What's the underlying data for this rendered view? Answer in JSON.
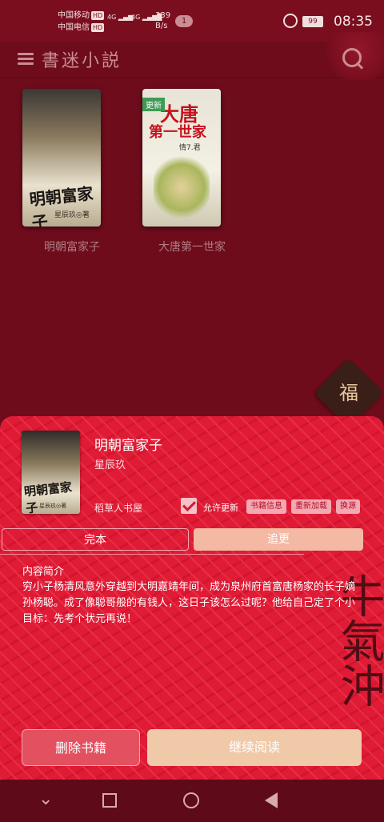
{
  "status_bar": {
    "carrier1": "中国移动",
    "carrier2": "中国电信",
    "hd": "HD",
    "signal1": "4G",
    "signal2": "4G",
    "speed_value": "339",
    "speed_unit": "B/s",
    "notification_count": "1",
    "battery": "99",
    "time": "08:35"
  },
  "app_bar": {
    "title": "書迷小説",
    "menu_icon": "hamburger-icon",
    "search_icon": "search-icon"
  },
  "bookshelf": {
    "books": [
      {
        "title": "明朝富家子",
        "cover_title": "明朝富家子",
        "cover_author": "星辰玖◎著"
      },
      {
        "title": "大唐第一世家",
        "cover_title_line1": "大唐",
        "cover_title_line2": "第一世家",
        "cover_author": "情7.君",
        "tag": "更新"
      }
    ],
    "fu_badge": "福"
  },
  "detail": {
    "title": "明朝富家子",
    "author": "星辰玖",
    "source": "稻草人书屋",
    "allow_update_label": "允许更新",
    "allow_update_checked": true,
    "cover_title": "明朝富家子",
    "cover_author": "星辰玖◎著",
    "chips": [
      "书籍信息",
      "重新加载",
      "换源"
    ],
    "status_tabs": [
      "完本",
      "追更"
    ],
    "intro_heading": "内容简介",
    "intro_text": "穷小子杨清风意外穿越到大明嘉靖年间，成为泉州府首富唐杨家的长子嫡孙杨聪。成了像聪哥般的有钱人，这日子该怎么过呢？他给自己定了个小目标：先考个状元再说！",
    "delete_label": "删除书籍",
    "continue_label": "继续阅读",
    "calligraphy": "牛氣沖"
  },
  "nav_bar": {
    "back_icon": "chevron-down-icon",
    "recent_icon": "square-icon",
    "home_icon": "circle-icon",
    "triangle_icon": "triangle-back-icon"
  },
  "colors": {
    "background": "#6e0c1c",
    "sheet": "#e01b35",
    "accent_pink": "#f3a8b2",
    "continue_button": "#f0c9a8"
  }
}
